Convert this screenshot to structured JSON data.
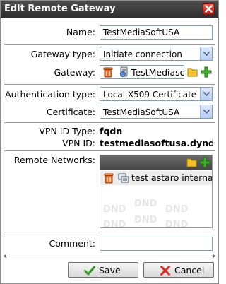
{
  "dialog": {
    "title": "Edit Remote Gateway"
  },
  "form": {
    "name_label": "Name:",
    "name_value": "TestMediaSoftUSA",
    "gateway_type_label": "Gateway type:",
    "gateway_type_value": "Initiate connection",
    "gateway_label": "Gateway:",
    "gateway_value": "TestMediasoftUSA",
    "auth_type_label": "Authentication type:",
    "auth_type_value": "Local X509 Certificate",
    "certificate_label": "Certificate:",
    "certificate_value": "TestMediaSoftUSA",
    "vpn_id_type_label": "VPN ID Type:",
    "vpn_id_type_value": "fqdn",
    "vpn_id_label": "VPN ID:",
    "vpn_id_value": "testmediasoftusa.dyndns",
    "remote_networks_label": "Remote Networks:",
    "remote_networks": [
      "test astaro internal"
    ],
    "dnd_watermark": "DND",
    "comment_label": "Comment:",
    "comment_value": ""
  },
  "buttons": {
    "save": "Save",
    "cancel": "Cancel"
  },
  "colors": {
    "titlebar": "#3c3c3c",
    "close": "#d9291c",
    "save_icon": "#2f9a1e",
    "cancel_icon": "#d9291c"
  }
}
